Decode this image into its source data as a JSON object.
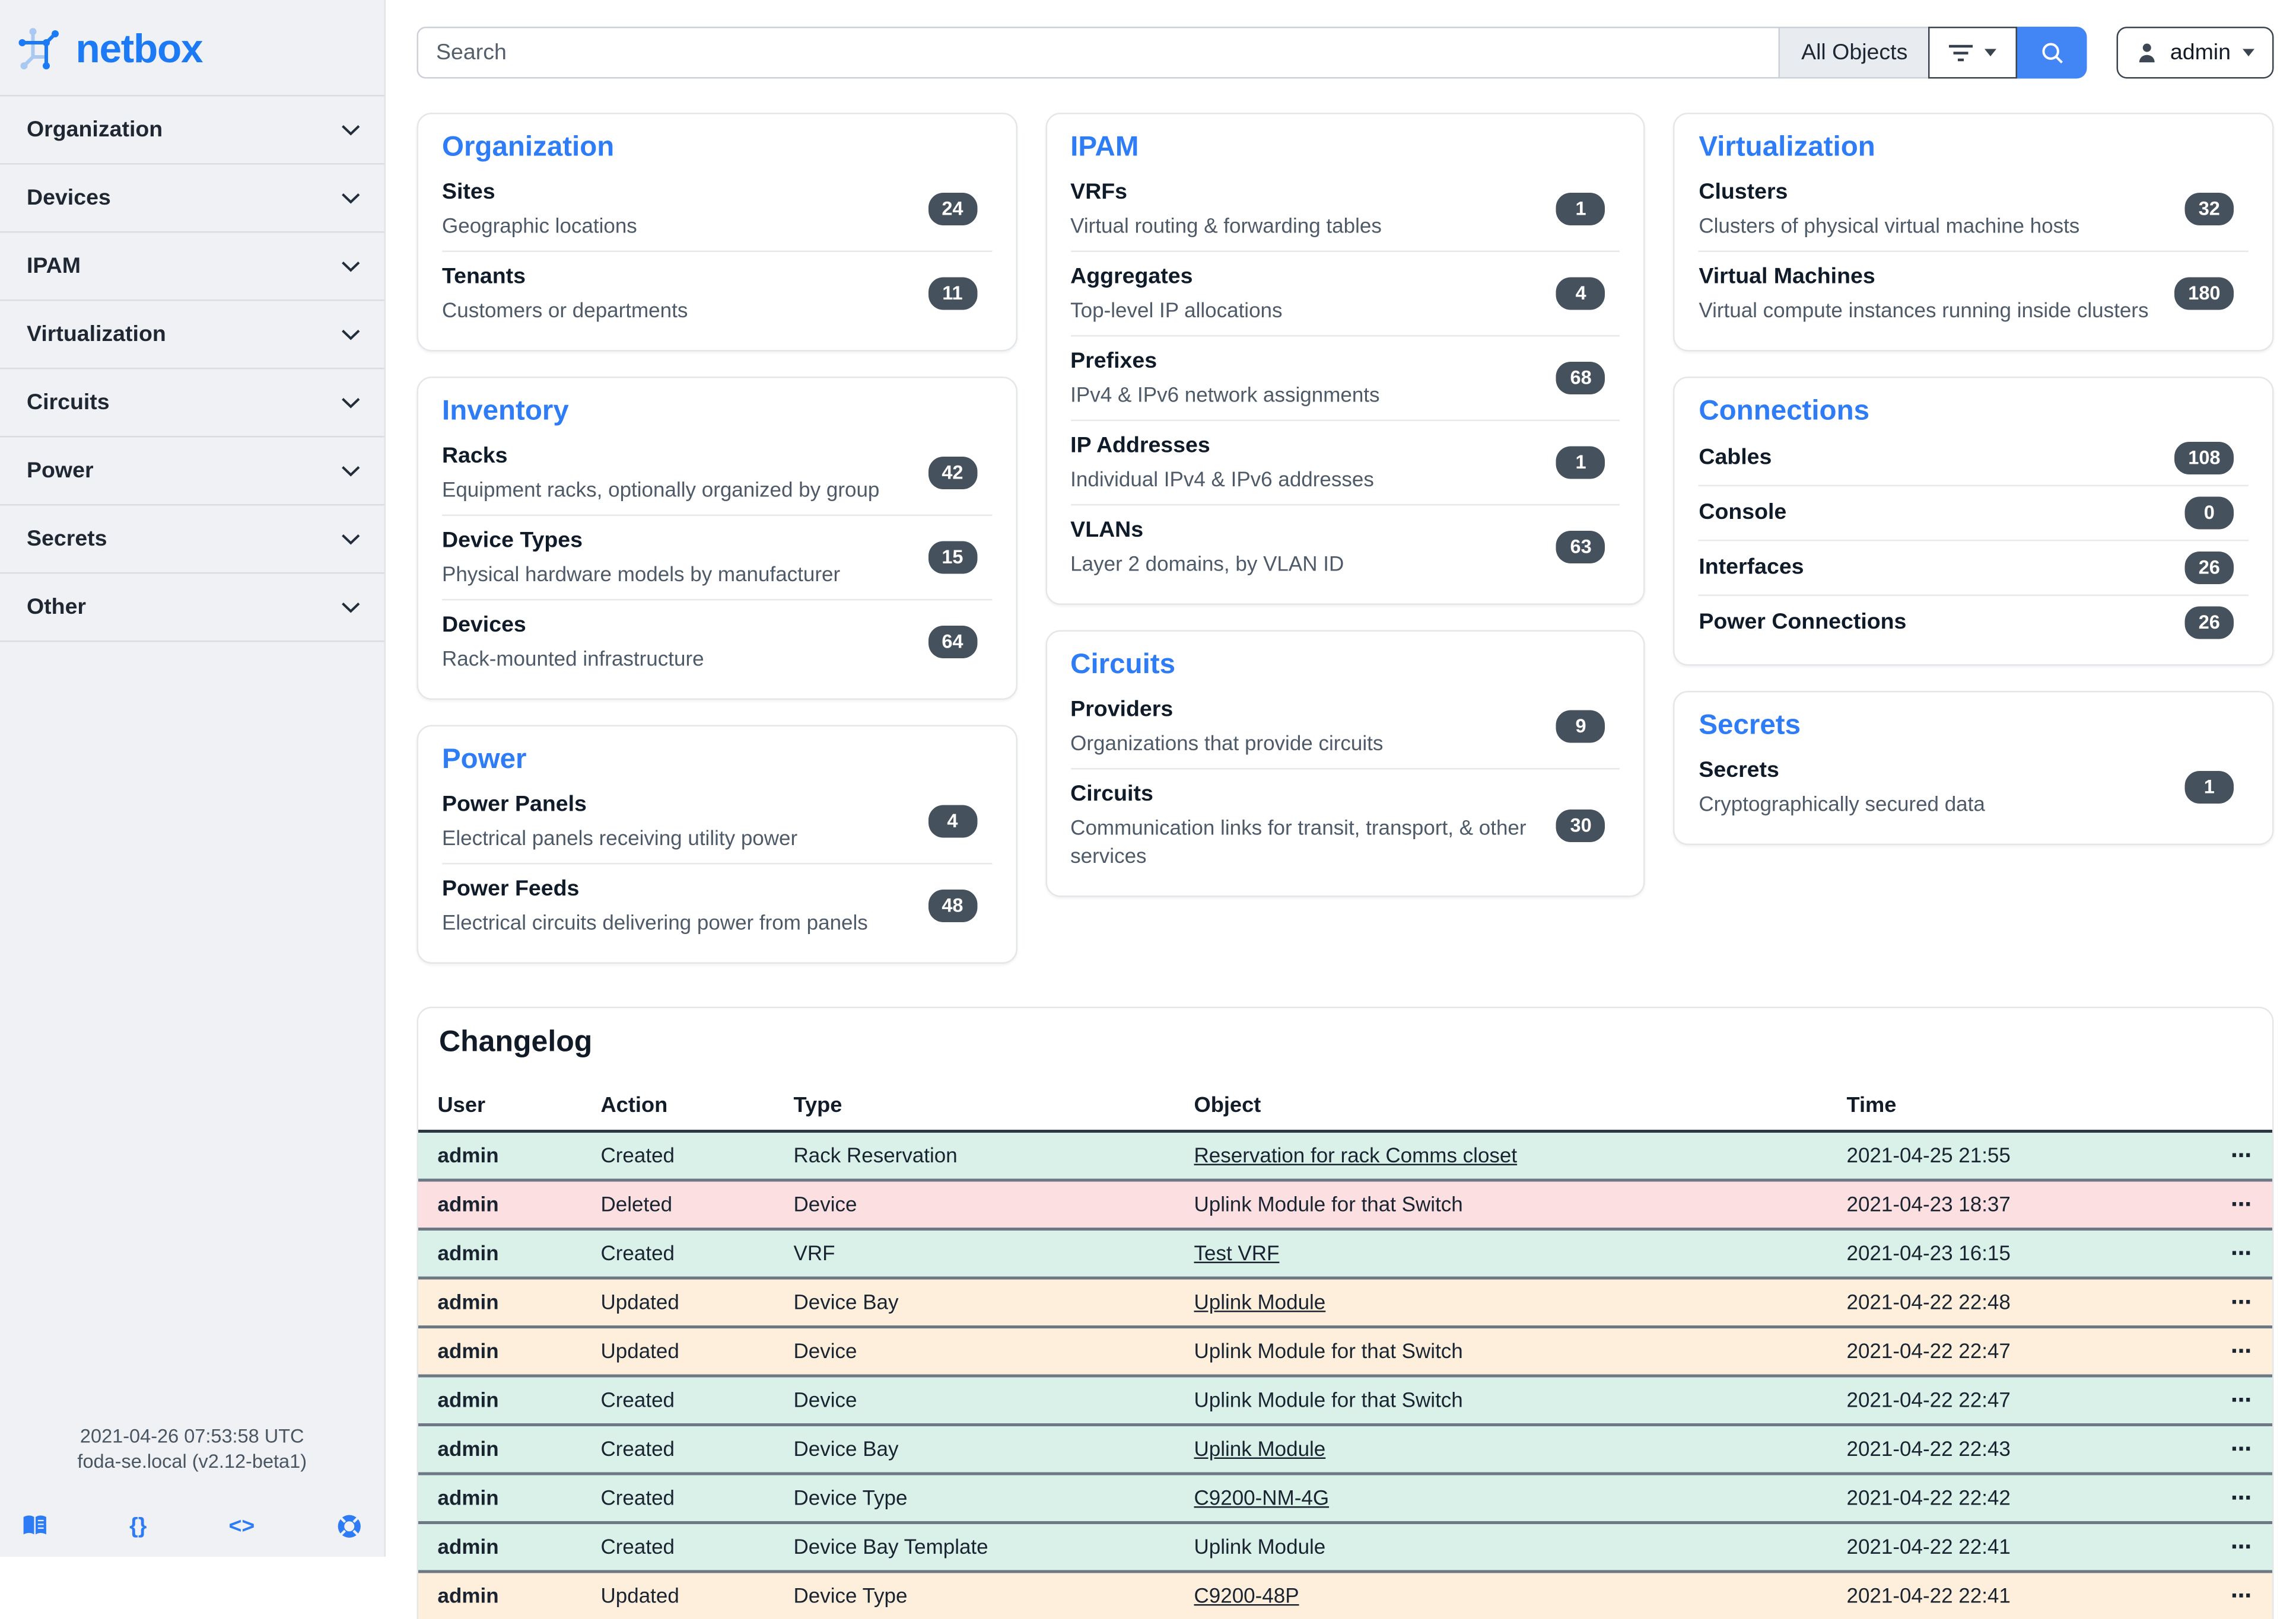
{
  "brand": {
    "name": "netbox"
  },
  "topbar": {
    "search_placeholder": "Search",
    "scope_label": "All Objects",
    "user_label": "admin"
  },
  "sidebar": {
    "items": [
      {
        "label": "Organization"
      },
      {
        "label": "Devices"
      },
      {
        "label": "IPAM"
      },
      {
        "label": "Virtualization"
      },
      {
        "label": "Circuits"
      },
      {
        "label": "Power"
      },
      {
        "label": "Secrets"
      },
      {
        "label": "Other"
      }
    ],
    "footer_time": "2021-04-26 07:53:58 UTC",
    "footer_host": "foda-se.local (v2.12-beta1)",
    "footer_glyphs": {
      "braces": "{}",
      "code": "<>"
    }
  },
  "cards": {
    "organization": {
      "title": "Organization",
      "items": [
        {
          "label": "Sites",
          "desc": "Geographic locations",
          "count": "24"
        },
        {
          "label": "Tenants",
          "desc": "Customers or departments",
          "count": "11"
        }
      ]
    },
    "inventory": {
      "title": "Inventory",
      "items": [
        {
          "label": "Racks",
          "desc": "Equipment racks, optionally organized by group",
          "count": "42"
        },
        {
          "label": "Device Types",
          "desc": "Physical hardware models by manufacturer",
          "count": "15"
        },
        {
          "label": "Devices",
          "desc": "Rack-mounted infrastructure",
          "count": "64"
        }
      ]
    },
    "power": {
      "title": "Power",
      "items": [
        {
          "label": "Power Panels",
          "desc": "Electrical panels receiving utility power",
          "count": "4"
        },
        {
          "label": "Power Feeds",
          "desc": "Electrical circuits delivering power from panels",
          "count": "48"
        }
      ]
    },
    "ipam": {
      "title": "IPAM",
      "items": [
        {
          "label": "VRFs",
          "desc": "Virtual routing & forwarding tables",
          "count": "1"
        },
        {
          "label": "Aggregates",
          "desc": "Top-level IP allocations",
          "count": "4"
        },
        {
          "label": "Prefixes",
          "desc": "IPv4 & IPv6 network assignments",
          "count": "68"
        },
        {
          "label": "IP Addresses",
          "desc": "Individual IPv4 & IPv6 addresses",
          "count": "1"
        },
        {
          "label": "VLANs",
          "desc": "Layer 2 domains, by VLAN ID",
          "count": "63"
        }
      ]
    },
    "circuits": {
      "title": "Circuits",
      "items": [
        {
          "label": "Providers",
          "desc": "Organizations that provide circuits",
          "count": "9"
        },
        {
          "label": "Circuits",
          "desc": "Communication links for transit, transport, & other services",
          "count": "30"
        }
      ]
    },
    "virtualization": {
      "title": "Virtualization",
      "items": [
        {
          "label": "Clusters",
          "desc": "Clusters of physical virtual machine hosts",
          "count": "32"
        },
        {
          "label": "Virtual Machines",
          "desc": "Virtual compute instances running inside clusters",
          "count": "180"
        }
      ]
    },
    "connections": {
      "title": "Connections",
      "items": [
        {
          "label": "Cables",
          "count": "108"
        },
        {
          "label": "Console",
          "count": "0"
        },
        {
          "label": "Interfaces",
          "count": "26"
        },
        {
          "label": "Power Connections",
          "count": "26"
        }
      ]
    },
    "secrets": {
      "title": "Secrets",
      "items": [
        {
          "label": "Secrets",
          "desc": "Cryptographically secured data",
          "count": "1"
        }
      ]
    }
  },
  "changelog": {
    "title": "Changelog",
    "headers": [
      "User",
      "Action",
      "Type",
      "Object",
      "Time"
    ],
    "menu_glyph": "⋯",
    "rows": [
      {
        "user": "admin",
        "action": "Created",
        "type": "Rack Reservation",
        "object": "Reservation for rack Comms closet",
        "time": "2021-04-25 21:55",
        "status": "created",
        "link": true
      },
      {
        "user": "admin",
        "action": "Deleted",
        "type": "Device",
        "object": "Uplink Module for that Switch",
        "time": "2021-04-23 18:37",
        "status": "deleted",
        "link": false
      },
      {
        "user": "admin",
        "action": "Created",
        "type": "VRF",
        "object": "Test VRF",
        "time": "2021-04-23 16:15",
        "status": "created",
        "link": true
      },
      {
        "user": "admin",
        "action": "Updated",
        "type": "Device Bay",
        "object": "Uplink Module",
        "time": "2021-04-22 22:48",
        "status": "updated",
        "link": true
      },
      {
        "user": "admin",
        "action": "Updated",
        "type": "Device",
        "object": "Uplink Module for that Switch",
        "time": "2021-04-22 22:47",
        "status": "updated",
        "link": false
      },
      {
        "user": "admin",
        "action": "Created",
        "type": "Device",
        "object": "Uplink Module for that Switch",
        "time": "2021-04-22 22:47",
        "status": "created",
        "link": false
      },
      {
        "user": "admin",
        "action": "Created",
        "type": "Device Bay",
        "object": "Uplink Module",
        "time": "2021-04-22 22:43",
        "status": "created",
        "link": true
      },
      {
        "user": "admin",
        "action": "Created",
        "type": "Device Type",
        "object": "C9200-NM-4G",
        "time": "2021-04-22 22:42",
        "status": "created",
        "link": true
      },
      {
        "user": "admin",
        "action": "Created",
        "type": "Device Bay Template",
        "object": "Uplink Module",
        "time": "2021-04-22 22:41",
        "status": "created",
        "link": false
      },
      {
        "user": "admin",
        "action": "Updated",
        "type": "Device Type",
        "object": "C9200-48P",
        "time": "2021-04-22 22:41",
        "status": "updated",
        "link": true
      }
    ]
  },
  "icons": {
    "logo": "netbox-network-logo",
    "nav_chevron": "chevron-down",
    "filter": "filter-lines",
    "search": "magnifier",
    "user": "person",
    "footer": [
      "book-icon",
      "braces-icon",
      "code-icon",
      "lifebuoy-icon"
    ]
  },
  "theme": {
    "accent_blue": "#2e7cf6",
    "logo_blue": "#1d7af5",
    "logo_blue_light": "#a9c9f2",
    "badge_bg": "#46515e",
    "search_button": "#4285f4",
    "row_created": "#d9f1e8",
    "row_deleted": "#fbdfe1",
    "row_updated": "#fdefdc",
    "sidebar_bg": "#eff1f4"
  }
}
